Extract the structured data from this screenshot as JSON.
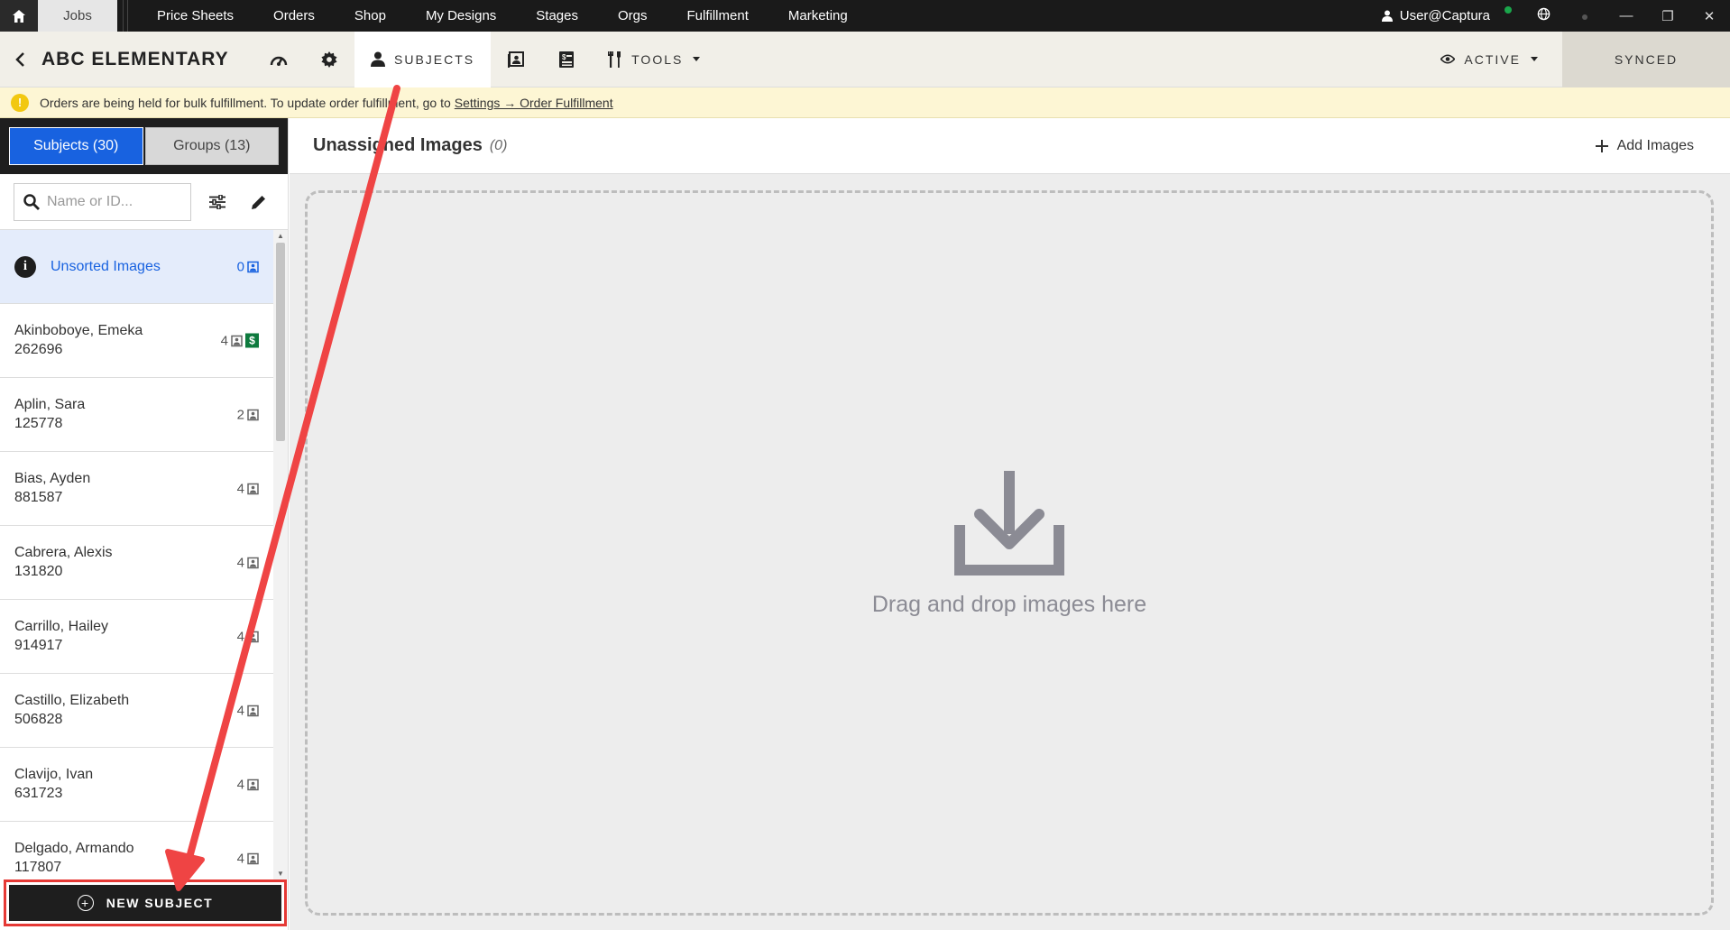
{
  "topnav": {
    "home_icon": "home-icon",
    "items": [
      {
        "label": "Jobs",
        "active": true
      },
      {
        "label": "Price Sheets"
      },
      {
        "label": "Orders"
      },
      {
        "label": "Shop"
      },
      {
        "label": "My Designs"
      },
      {
        "label": "Stages"
      },
      {
        "label": "Orgs"
      },
      {
        "label": "Fulfillment"
      },
      {
        "label": "Marketing"
      }
    ],
    "user": "User@Captura"
  },
  "toolbar": {
    "title": "ABC ELEMENTARY",
    "subjects_label": "SUBJECTS",
    "tools_label": "TOOLS",
    "status_label": "ACTIVE",
    "synced_label": "SYNCED"
  },
  "banner": {
    "text": "Orders are being held for bulk fulfillment. To update order fulfillment, go to",
    "link": "Settings → Order Fulfillment"
  },
  "sidebar": {
    "tabs": [
      {
        "label": "Subjects (30)",
        "active": true
      },
      {
        "label": "Groups (13)",
        "active": false
      }
    ],
    "search_placeholder": "Name or ID...",
    "unsorted": {
      "label": "Unsorted Images",
      "count": "0"
    },
    "subjects": [
      {
        "name": "Akinboboye, Emeka",
        "id": "262696",
        "count": "4",
        "paid": true
      },
      {
        "name": "Aplin, Sara",
        "id": "125778",
        "count": "2",
        "paid": false
      },
      {
        "name": "Bias, Ayden",
        "id": "881587",
        "count": "4",
        "paid": false
      },
      {
        "name": "Cabrera, Alexis",
        "id": "131820",
        "count": "4",
        "paid": false
      },
      {
        "name": "Carrillo, Hailey",
        "id": "914917",
        "count": "4",
        "paid": false
      },
      {
        "name": "Castillo, Elizabeth",
        "id": "506828",
        "count": "4",
        "paid": false
      },
      {
        "name": "Clavijo, Ivan",
        "id": "631723",
        "count": "4",
        "paid": false
      },
      {
        "name": "Delgado, Armando",
        "id": "117807",
        "count": "4",
        "paid": false
      }
    ],
    "new_subject_label": "NEW SUBJECT"
  },
  "main": {
    "title": "Unassigned Images",
    "count": "(0)",
    "add_images_label": "Add Images",
    "dropzone_text": "Drag and drop images here"
  },
  "colors": {
    "accent_blue": "#1862e0",
    "highlight_red": "#e53935",
    "paid_green": "#0e7a3e",
    "banner_bg": "#fdf6d4"
  }
}
